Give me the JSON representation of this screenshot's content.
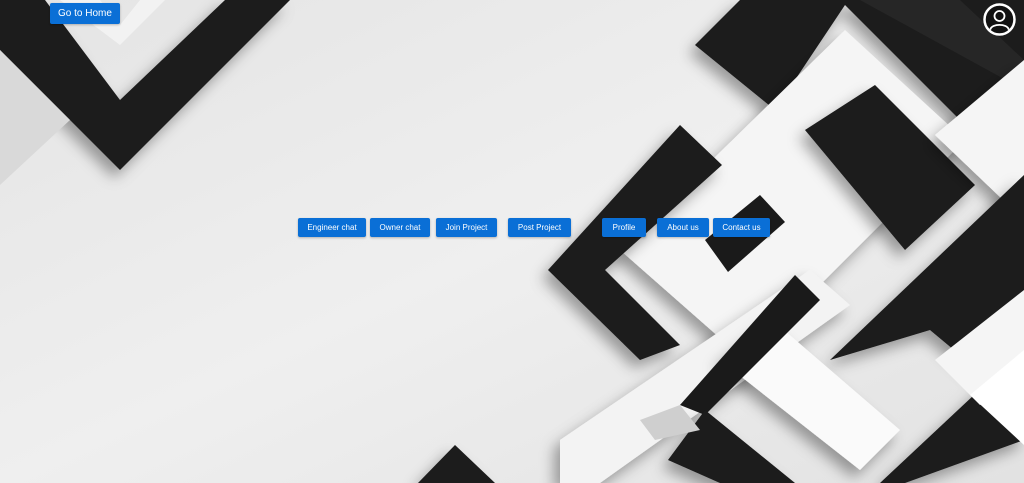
{
  "home_button": {
    "label": "Go to Home"
  },
  "nav": {
    "engineer_chat": "Engineer chat",
    "owner_chat": "Owner chat",
    "join_project": "Join Project",
    "post_project": "Post Project",
    "profile": "Profile",
    "about_us": "About us",
    "contact_us": "Contact us"
  },
  "avatar": {
    "icon": "user-icon"
  },
  "colors": {
    "button": "#0a6fd6",
    "button_text": "#ffffff",
    "background": "#ececec",
    "dark_shape": "#1a1a1a",
    "light_shape": "#f7f7f7"
  }
}
